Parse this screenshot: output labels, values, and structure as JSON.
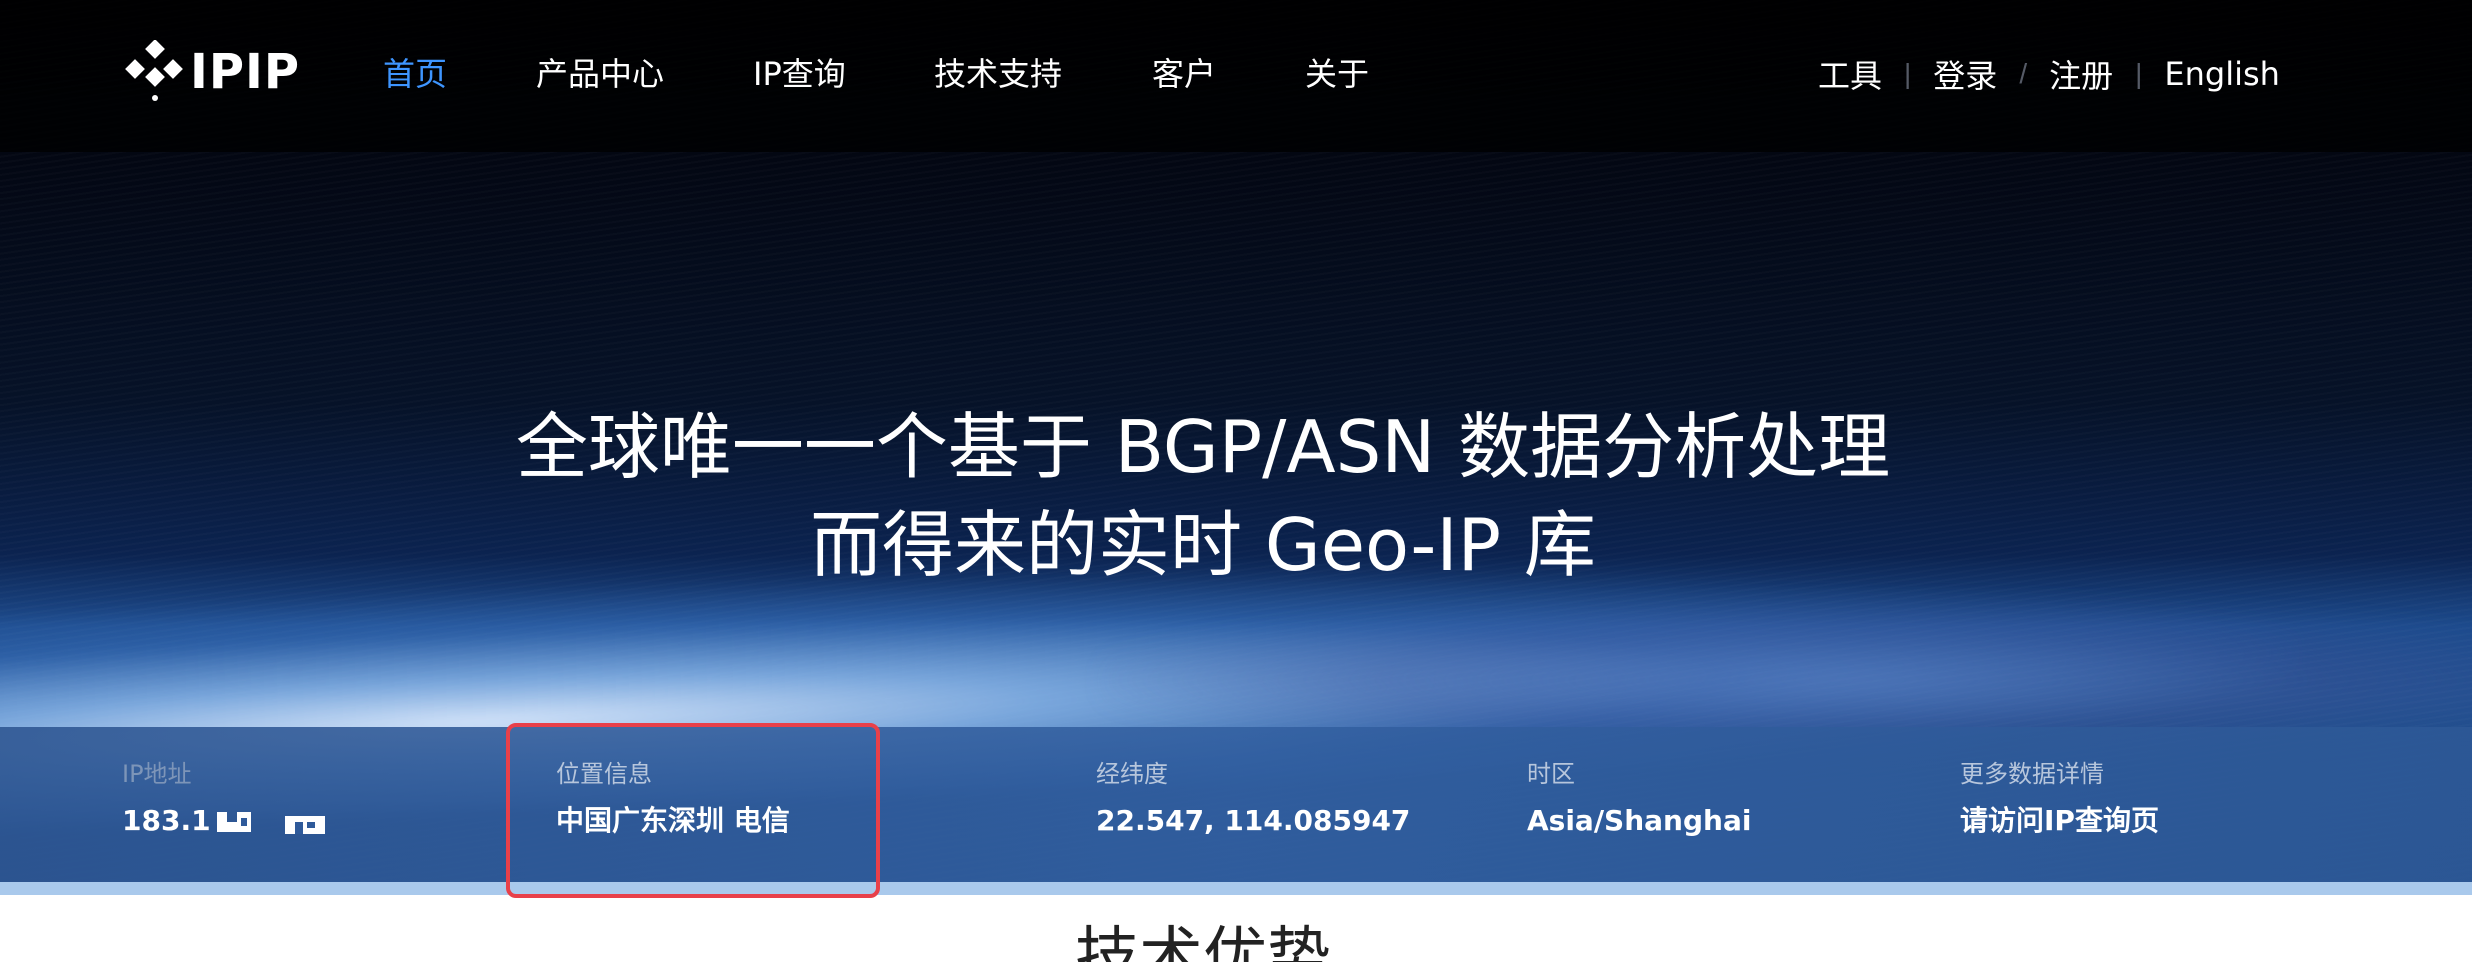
{
  "nav": {
    "logo_text": "IPIP",
    "items": [
      {
        "label": "首页",
        "active": true
      },
      {
        "label": "产品中心",
        "active": false
      },
      {
        "label": "IP查询",
        "active": false
      },
      {
        "label": "技术支持",
        "active": false
      },
      {
        "label": "客户",
        "active": false
      },
      {
        "label": "关于",
        "active": false
      }
    ],
    "right": {
      "tools": "工具",
      "login": "登录",
      "register": "注册",
      "english": "English",
      "sep_bar": "|",
      "sep_slash": "/"
    }
  },
  "hero": {
    "line1": "全球唯一一个基于 BGP/ASN 数据分析处理",
    "line2": "而得来的实时 Geo-IP 库"
  },
  "info": {
    "ip": {
      "label": "IP地址",
      "value": "183.1"
    },
    "location": {
      "label": "位置信息",
      "value": "中国广东深圳 电信"
    },
    "coords": {
      "label": "经纬度",
      "value": "22.547, 114.085947"
    },
    "timezone": {
      "label": "时区",
      "value": "Asia/Shanghai"
    },
    "more": {
      "label": "更多数据详情",
      "value": "请访问IP查询页"
    }
  },
  "section": {
    "title": "技术优势"
  },
  "colors": {
    "accent": "#3e95ff",
    "highlight": "#e8404a",
    "infobar": "#2f5a9a"
  }
}
